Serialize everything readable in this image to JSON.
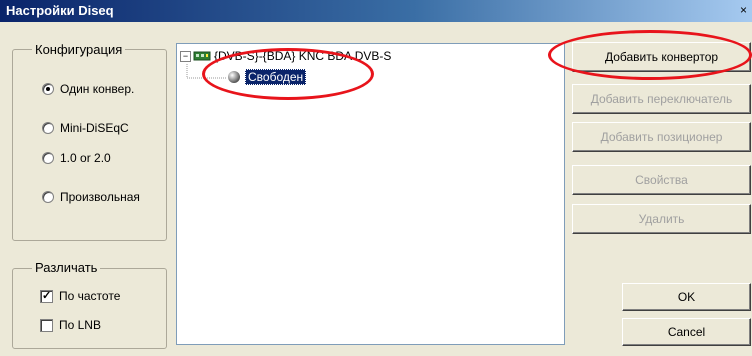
{
  "window": {
    "title": "Настройки Diseq",
    "close_glyph": "×"
  },
  "config_group": {
    "legend": "Конфигурация",
    "options": [
      {
        "label": "Один конвер.",
        "selected": true
      },
      {
        "label": "Mini-DiSEqC",
        "selected": false
      },
      {
        "label": "1.0 or 2.0",
        "selected": false
      },
      {
        "label": "Произвольная",
        "selected": false
      }
    ]
  },
  "distinguish_group": {
    "legend": "Различать",
    "options": [
      {
        "label": "По частоте",
        "checked": true
      },
      {
        "label": "По LNB",
        "checked": false
      }
    ]
  },
  "tree": {
    "root": {
      "label": "{DVB-S}-{BDA} KNC BDA DVB-S",
      "expander": "⊟",
      "icon": "tv-card-icon"
    },
    "child": {
      "label": "Свободен",
      "icon": "sphere-icon"
    }
  },
  "buttons": {
    "add_converter": "Добавить конвертор",
    "add_switch": "Добавить переключатель",
    "add_positioner": "Добавить позиционер",
    "properties": "Свойства",
    "delete": "Удалить",
    "ok": "OK",
    "cancel": "Cancel"
  },
  "colors": {
    "annotation_red": "#e8141b",
    "title_bar": "#0a246a"
  }
}
